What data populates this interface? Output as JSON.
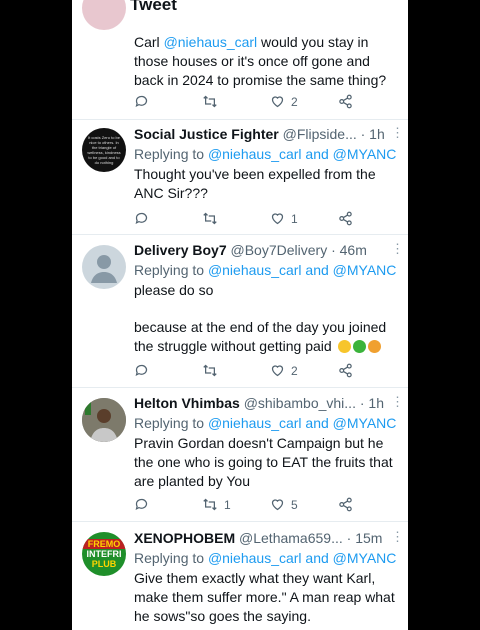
{
  "header": {
    "back_icon": "arrow-left-icon",
    "title": "Tweet"
  },
  "tweets": [
    {
      "name": "",
      "handle": "",
      "time": "",
      "body_prefix": "Carl ",
      "body_mention": "@niehaus_carl",
      "body": "  would you stay in those houses or it's once off gone and back in 2024 to promise the same thing?",
      "replies": "",
      "retweets": "",
      "likes": "2"
    },
    {
      "name": "Social Justice Fighter",
      "handle": "@Flipside...",
      "time": "· 1h",
      "replying_label": "Replying to",
      "replying_to": "@niehaus_carl and @MYANC",
      "body": "Thought you've been expelled from the ANC Sir???",
      "replies": "",
      "retweets": "",
      "likes": "1"
    },
    {
      "name": "Delivery Boy7",
      "handle": "@Boy7Delivery",
      "time": "· 46m",
      "replying_label": "Replying to",
      "replying_to": "@niehaus_carl and @MYANC",
      "body_line1": "please do so",
      "body_line2": "because at the end of the day you joined the struggle without getting paid",
      "replies": "",
      "retweets": "",
      "likes": "2"
    },
    {
      "name": "Helton Vhimbas",
      "handle": "@shibambo_vhi...",
      "time": "· 1h",
      "replying_label": "Replying to",
      "replying_to": "@niehaus_carl and @MYANC",
      "body": "Pravin Gordan doesn't Campaign but he the one who is going to EAT the fruits that are planted by You",
      "replies": "",
      "retweets": "1",
      "likes": "5"
    },
    {
      "name": "XENOPHOBEM",
      "handle": "@Lethama659...",
      "time": "· 15m",
      "replying_label": "Replying to",
      "replying_to": "@niehaus_carl and @MYANC",
      "body": "Give them exactly what they want Karl, make them suffer more.\" A man reap what he sows\"so goes the saying."
    }
  ],
  "avatars": {
    "t2_text": "It costs Zero to be nice to others. In the triangle of wellness, kindness to be good and to do nothing",
    "t5_text_top": "FREMO",
    "t5_text_mid": "INTEFRI",
    "t5_text_bot": "PLUB"
  },
  "colors": {
    "accent": "#1d9bf0",
    "text": "#0f1419",
    "muted": "#536471"
  }
}
